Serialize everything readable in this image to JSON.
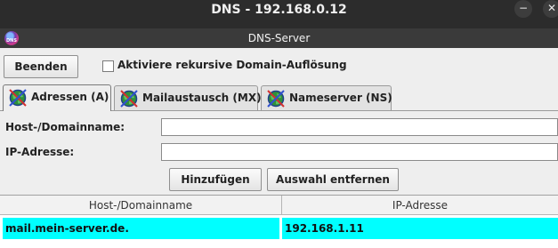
{
  "window": {
    "title": "DNS - 192.168.0.12",
    "minimize_glyph": "−",
    "close_glyph": "✕"
  },
  "app": {
    "title": "DNS-Server",
    "icon_name": "dns-globe-icon",
    "icon_text": "DNS"
  },
  "toolbar": {
    "quit_label": "Beenden",
    "recursive_label": "Aktiviere rekursive Domain-Auflösung",
    "recursive_checked": false
  },
  "tabs": [
    {
      "label": "Adressen (A)",
      "icon": "globe-icon",
      "active": true
    },
    {
      "label": "Mailaustausch (MX)",
      "icon": "globe-icon",
      "active": false
    },
    {
      "label": "Nameserver (NS)",
      "icon": "globe-icon",
      "active": false
    }
  ],
  "form": {
    "host_label": "Host-/Domainname:",
    "host_value": "",
    "ip_label": "IP-Adresse:",
    "ip_value": "",
    "add_label": "Hinzufügen",
    "remove_label": "Auswahl entfernen"
  },
  "table": {
    "columns": [
      "Host-/Domainname",
      "IP-Adresse"
    ],
    "rows": [
      {
        "host": "mail.mein-server.de.",
        "ip": "192.168.1.11",
        "selected": true
      }
    ]
  },
  "colors": {
    "selection": "#00ffff",
    "titlebar": "#2c2c2c",
    "panel": "#eeeeee"
  }
}
